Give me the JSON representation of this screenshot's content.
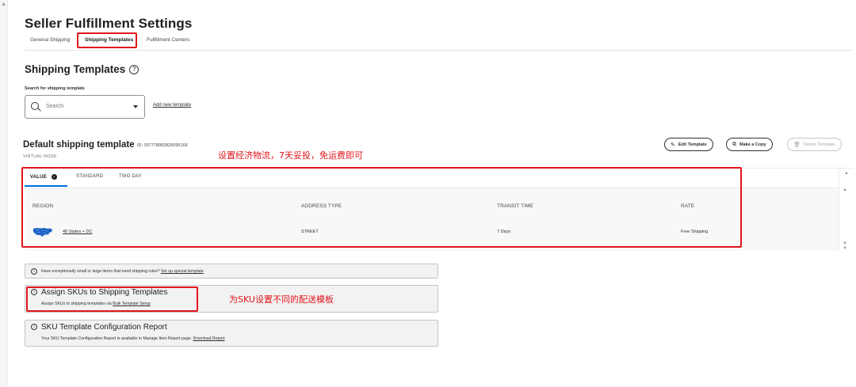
{
  "page": {
    "title": "Seller Fulfillment Settings"
  },
  "tabs": [
    {
      "label": "General Shipping"
    },
    {
      "label": "Shipping Templates"
    },
    {
      "label": "Fulfillment Centers"
    }
  ],
  "section": {
    "title": "Shipping Templates",
    "help_icon": "?"
  },
  "search": {
    "label": "Search for shipping template",
    "placeholder": "Search"
  },
  "add_template_link": "Add new template",
  "template": {
    "title": "Default shipping template",
    "id_text": "ID: 357778982825095169",
    "node": "VIRTUAL NODE"
  },
  "actions": {
    "edit": "Edit Template",
    "copy": "Make a Copy",
    "delete": "Delete Template"
  },
  "annotations": {
    "shipping_note": "设置经济物流，7天妥投，免运费即可",
    "sku_note": "为SKU设置不同的配送模板"
  },
  "method_tabs": [
    {
      "label": "VALUE",
      "selected": true
    },
    {
      "label": "STANDARD"
    },
    {
      "label": "TWO DAY"
    }
  ],
  "table": {
    "headers": [
      "REGION",
      "ADDRESS TYPE",
      "TRANSIT TIME",
      "RATE"
    ],
    "rows": [
      {
        "region": "48 States + DC",
        "address_type": "STREET",
        "transit_time": "7 Days",
        "rate": "Free Shipping"
      }
    ]
  },
  "info": {
    "special": {
      "text": "Have exceptionally small or large items that need shipping rules?",
      "link": "Set up special template"
    },
    "assign": {
      "title": "Assign SKUs to Shipping Templates",
      "text": "Assign SKUs to shipping templates via",
      "link": "Bulk Template Setup"
    },
    "report": {
      "title": "SKU Template Configuration Report",
      "text": "Your SKU Template Configuration Report is available in Manage Item Report page.",
      "link": "Download Report"
    }
  },
  "colors": {
    "annotation_red": "#e1161c",
    "active_tab_blue": "#0071dc"
  }
}
